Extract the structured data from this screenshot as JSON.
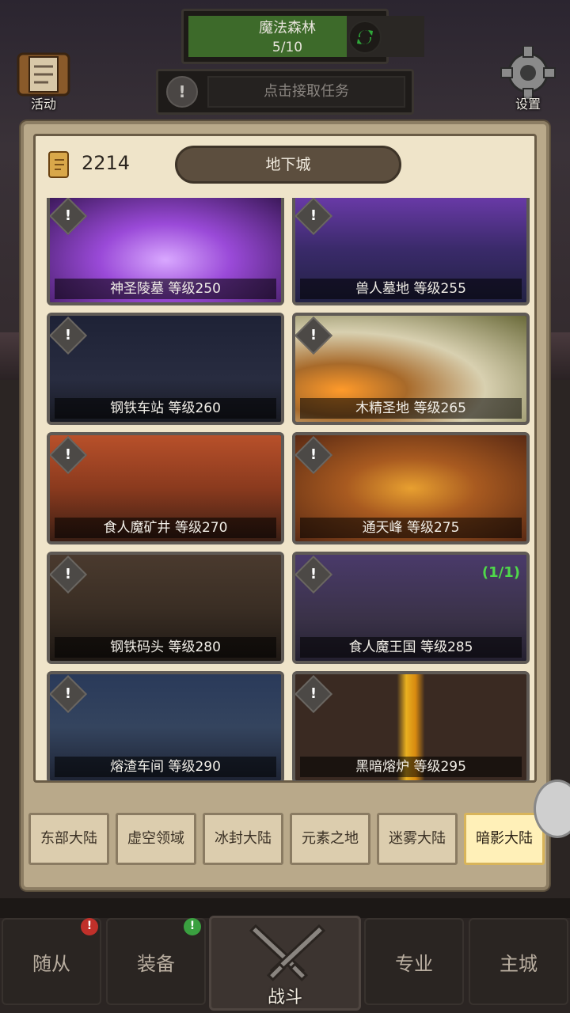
{
  "hud": {
    "zone_name": "魔法森林",
    "zone_progress": "5/10",
    "zone_progress_fraction": 0.5,
    "task_prompt": "点击接取任务",
    "activity_label": "活动",
    "settings_label": "设置"
  },
  "dungeon_panel": {
    "currency": "2214",
    "title": "地下城",
    "dungeons": [
      {
        "caption": "神圣陵墓 等级250",
        "alert": "!",
        "count": ""
      },
      {
        "caption": "兽人墓地 等级255",
        "alert": "!",
        "count": ""
      },
      {
        "caption": "钢铁车站 等级260",
        "alert": "!",
        "count": ""
      },
      {
        "caption": "木精圣地 等级265",
        "alert": "!",
        "count": ""
      },
      {
        "caption": "食人魔矿井 等级270",
        "alert": "!",
        "count": ""
      },
      {
        "caption": "通天峰 等级275",
        "alert": "!",
        "count": ""
      },
      {
        "caption": "钢铁码头 等级280",
        "alert": "!",
        "count": ""
      },
      {
        "caption": "食人魔王国 等级285",
        "alert": "!",
        "count": "(1/1)"
      },
      {
        "caption": "熔渣车间 等级290",
        "alert": "!",
        "count": ""
      },
      {
        "caption": "黑暗熔炉 等级295",
        "alert": "!",
        "count": ""
      }
    ],
    "regions": [
      {
        "label": "东部大陆",
        "active": false
      },
      {
        "label": "虚空领域",
        "active": false
      },
      {
        "label": "冰封大陆",
        "active": false
      },
      {
        "label": "元素之地",
        "active": false
      },
      {
        "label": "迷雾大陆",
        "active": false
      },
      {
        "label": "暗影大陆",
        "active": true
      }
    ]
  },
  "bottom_nav": {
    "followers": "随从",
    "equipment": "装备",
    "battle": "战斗",
    "profession": "专业",
    "main_city": "主城",
    "followers_badge": "!",
    "equipment_badge": "!"
  },
  "colors": {
    "progress_fill": "#3d6a2a",
    "count_green": "#4fd84a",
    "active_tab": "#fff0b8"
  }
}
